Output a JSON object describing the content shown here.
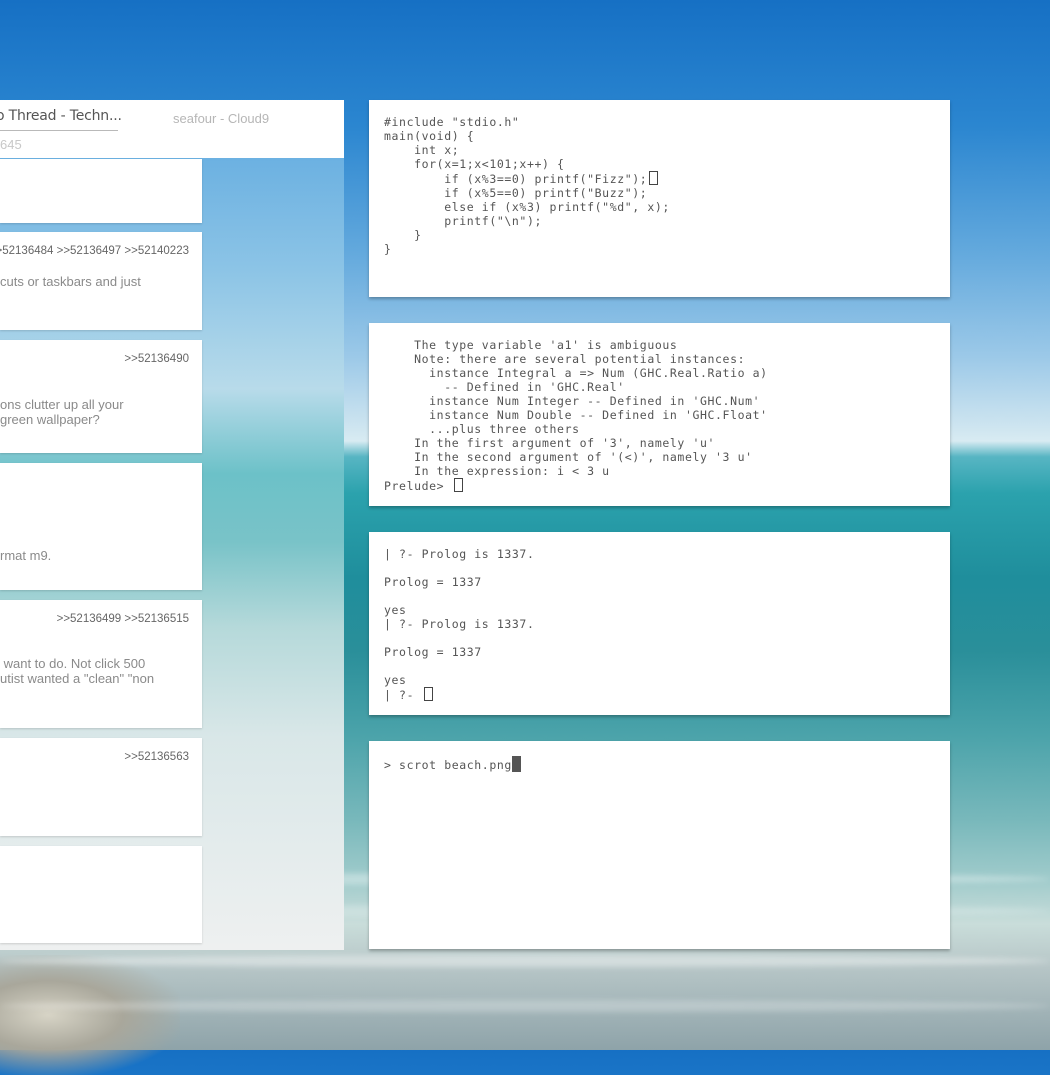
{
  "browser": {
    "tab_active": "o Thread - Techn...",
    "tab_other": "seafour - Cloud9",
    "post_number": "645",
    "posts": [
      {
        "refs": "",
        "body": ""
      },
      {
        "refs": ">>52136484 >>52136497 >>52140223",
        "body": "cuts or taskbars and just"
      },
      {
        "refs": ">>52136490",
        "body": "ons clutter up all your\ngreen wallpaper?"
      },
      {
        "refs": "",
        "body": "rmat m9."
      },
      {
        "refs": ">>52136499 >>52136515",
        "body": " want to do. Not click 500\nutist wanted a \"clean\" \"non"
      },
      {
        "refs": ">>52136563",
        "body": ""
      },
      {
        "refs": "",
        "body": ""
      }
    ]
  },
  "terminals": {
    "c_code": "#include \"stdio.h\"\nmain(void) {\n    int x;\n    for(x=1;x<101;x++) {\n        if (x%3==0) printf(\"Fizz\");",
    "c_code_rest": "        if (x%5==0) printf(\"Buzz\");\n        else if (x%3) printf(\"%d\", x);\n        printf(\"\\n\");\n    }\n}",
    "ghc_error": "    The type variable 'a1' is ambiguous\n    Note: there are several potential instances:\n      instance Integral a => Num (GHC.Real.Ratio a)\n        -- Defined in 'GHC.Real'\n      instance Num Integer -- Defined in 'GHC.Num'\n      instance Num Double -- Defined in 'GHC.Float'\n      ...plus three others\n    In the first argument of '3', namely 'u'\n    In the second argument of '(<)', namely '3 u'\n    In the expression: i < 3 u",
    "ghc_prompt": "Prelude> ",
    "prolog_session": "| ?- Prolog is 1337.\n\nProlog = 1337\n\nyes\n| ?- Prolog is 1337.\n\nProlog = 1337\n\nyes",
    "prolog_prompt": "| ?- ",
    "shell_command": "> scrot beach.png"
  }
}
